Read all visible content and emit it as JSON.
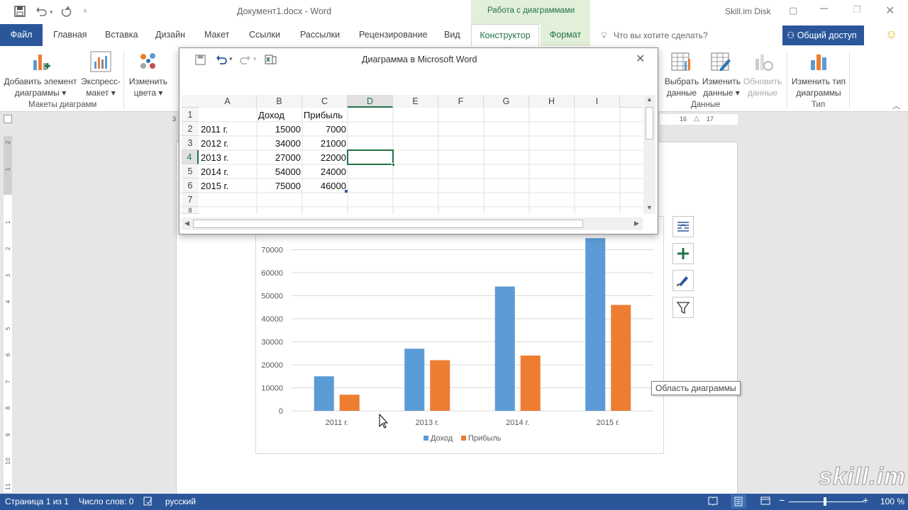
{
  "titlebar": {
    "doc_title": "Документ1.docx - Word",
    "context_tab": "Работа с диаграммами",
    "account": "Skill.im Disk"
  },
  "tabs": [
    {
      "label": "Файл"
    },
    {
      "label": "Главная"
    },
    {
      "label": "Вставка"
    },
    {
      "label": "Дизайн"
    },
    {
      "label": "Макет"
    },
    {
      "label": "Ссылки"
    },
    {
      "label": "Рассылки"
    },
    {
      "label": "Рецензирование"
    },
    {
      "label": "Вид"
    },
    {
      "label": "Конструктор"
    },
    {
      "label": "Формат"
    }
  ],
  "tell_me": "Что вы хотите сделать?",
  "share": "Общий доступ",
  "ribbon": {
    "add_element": [
      "Добавить элемент",
      "диаграммы"
    ],
    "express": [
      "Экспресс-",
      "макет"
    ],
    "change_colors": [
      "Изменить",
      "цвета"
    ],
    "group_layouts": "Макеты диаграмм",
    "select_data": [
      "Выбрать",
      "данные"
    ],
    "edit_data": [
      "Изменить",
      "данные"
    ],
    "refresh_data": [
      "Обновить",
      "данные"
    ],
    "group_data": "Данные",
    "change_type": [
      "Изменить тип",
      "диаграммы"
    ],
    "group_type": "Тип"
  },
  "ruler": {
    "marks": [
      "3",
      "16",
      "17"
    ]
  },
  "dialog": {
    "title": "Диаграмма в Microsoft Word",
    "columns": [
      "A",
      "B",
      "C",
      "D",
      "E",
      "F",
      "G",
      "H",
      "I"
    ],
    "rows": [
      "1",
      "2",
      "3",
      "4",
      "5",
      "6",
      "7",
      "8"
    ],
    "cells": [
      [
        "",
        "Доход",
        "Прибыль"
      ],
      [
        "2011 г.",
        "15000",
        "7000"
      ],
      [
        "2012 г.",
        "34000",
        "21000"
      ],
      [
        "2013 г.",
        "27000",
        "22000"
      ],
      [
        "2014 г.",
        "54000",
        "24000"
      ],
      [
        "2015 г.",
        "75000",
        "46000"
      ]
    ]
  },
  "tooltip": "Область диаграммы",
  "statusbar": {
    "page": "Страница 1 из 1",
    "words": "Число слов: 0",
    "lang": "русский",
    "zoom": "100 %"
  },
  "watermark": "skill.im",
  "colors": {
    "accent": "#2b579a",
    "series1": "#5b9bd5",
    "series2": "#ed7d31",
    "context": "#217346"
  },
  "chart_data": {
    "type": "bar",
    "categories": [
      "2011 г.",
      "2012 г.",
      "2013 г.",
      "2014 г.",
      "2015 г."
    ],
    "series": [
      {
        "name": "Доход",
        "values": [
          15000,
          34000,
          27000,
          54000,
          75000
        ]
      },
      {
        "name": "Прибыль",
        "values": [
          7000,
          21000,
          22000,
          24000,
          46000
        ]
      }
    ],
    "visible_categories": [
      "2011 г.",
      "2013 г.",
      "2014 г.",
      "2015 г."
    ],
    "visible_revenue": [
      15000,
      27000,
      54000,
      75000
    ],
    "visible_profit": [
      7000,
      22000,
      24000,
      46000
    ],
    "y_ticks": [
      "0",
      "10000",
      "20000",
      "30000",
      "40000",
      "50000",
      "60000",
      "70000"
    ],
    "ylim": [
      0,
      80000
    ],
    "legend": "bottom",
    "grid": true
  }
}
